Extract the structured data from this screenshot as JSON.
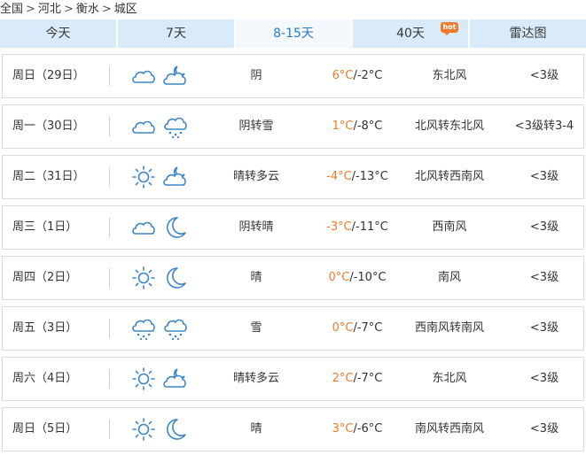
{
  "breadcrumb": [
    "全国",
    "河北",
    "衡水",
    "城区"
  ],
  "tabs": [
    {
      "label": "今天",
      "active": false
    },
    {
      "label": "7天",
      "active": false
    },
    {
      "label": "8-15天",
      "active": true
    },
    {
      "label": "40天",
      "active": false,
      "badge": "hot"
    },
    {
      "label": "雷达图",
      "active": false
    }
  ],
  "colors": {
    "accent": "#2b7bc0",
    "tab_bg": "#d9ebf8",
    "temp_high": "#f07a2b",
    "icon": "#3d86c6"
  },
  "forecast": [
    {
      "date": "周日（29日）",
      "icons": [
        "cloud-icon",
        "cloudy-night-icon"
      ],
      "weather": "阴",
      "high": "6°C",
      "low": "/-2°C",
      "wind": "东北风",
      "level": "<3级"
    },
    {
      "date": "周一（30日）",
      "icons": [
        "cloud-icon",
        "snow-icon"
      ],
      "weather": "阴转雪",
      "high": "1°C",
      "low": "/-8°C",
      "wind": "北风转东北风",
      "level": "<3级转3-4"
    },
    {
      "date": "周二（31日）",
      "icons": [
        "sun-icon",
        "cloudy-night-icon"
      ],
      "weather": "晴转多云",
      "high": "-4°C",
      "low": "/-13°C",
      "wind": "北风转西南风",
      "level": "<3级"
    },
    {
      "date": "周三（1日）",
      "icons": [
        "cloud-icon",
        "moon-icon"
      ],
      "weather": "阴转晴",
      "high": "-3°C",
      "low": "/-11°C",
      "wind": "西南风",
      "level": "<3级"
    },
    {
      "date": "周四（2日）",
      "icons": [
        "sun-icon",
        "moon-icon"
      ],
      "weather": "晴",
      "high": "0°C",
      "low": "/-10°C",
      "wind": "南风",
      "level": "<3级"
    },
    {
      "date": "周五（3日）",
      "icons": [
        "snow-icon",
        "snow-icon"
      ],
      "weather": "雪",
      "high": "0°C",
      "low": "/-7°C",
      "wind": "西南风转南风",
      "level": "<3级"
    },
    {
      "date": "周六（4日）",
      "icons": [
        "sun-icon",
        "cloudy-night-icon"
      ],
      "weather": "晴转多云",
      "high": "2°C",
      "low": "/-7°C",
      "wind": "东北风",
      "level": "<3级"
    },
    {
      "date": "周日（5日）",
      "icons": [
        "sun-icon",
        "moon-icon"
      ],
      "weather": "晴",
      "high": "3°C",
      "low": "/-6°C",
      "wind": "南风转西南风",
      "level": "<3级"
    }
  ]
}
